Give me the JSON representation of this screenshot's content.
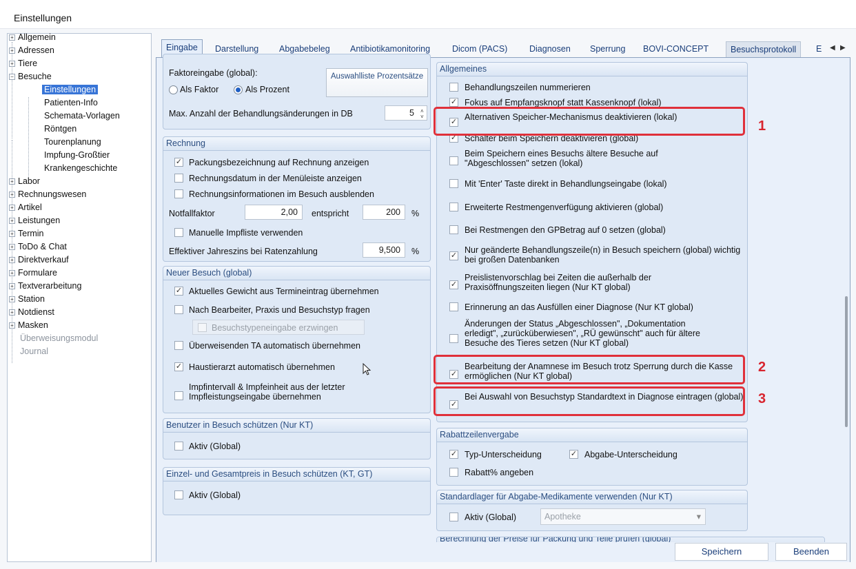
{
  "window": {
    "title": "Einstellungen"
  },
  "tree": {
    "items": [
      {
        "label": "Allgemein",
        "exp": "+"
      },
      {
        "label": "Adressen",
        "exp": "+"
      },
      {
        "label": "Tiere",
        "exp": "+"
      },
      {
        "label": "Besuche",
        "exp": "−"
      },
      {
        "label": "Einstellungen"
      },
      {
        "label": "Patienten-Info"
      },
      {
        "label": "Schemata-Vorlagen"
      },
      {
        "label": "Röntgen"
      },
      {
        "label": "Tourenplanung"
      },
      {
        "label": "Impfung-Großtier"
      },
      {
        "label": "Krankengeschichte"
      },
      {
        "label": "Labor",
        "exp": "+"
      },
      {
        "label": "Rechnungswesen",
        "exp": "+"
      },
      {
        "label": "Artikel",
        "exp": "+"
      },
      {
        "label": "Leistungen",
        "exp": "+"
      },
      {
        "label": "Termin",
        "exp": "+"
      },
      {
        "label": "ToDo & Chat",
        "exp": "+"
      },
      {
        "label": "Direktverkauf",
        "exp": "+"
      },
      {
        "label": "Formulare",
        "exp": "+"
      },
      {
        "label": "Textverarbeitung",
        "exp": "+"
      },
      {
        "label": "Station",
        "exp": "+"
      },
      {
        "label": "Notdienst",
        "exp": "+"
      },
      {
        "label": "Masken",
        "exp": "+"
      },
      {
        "label": "Überweisungsmodul"
      },
      {
        "label": "Journal"
      }
    ]
  },
  "tabs": [
    "Eingabe",
    "Darstellung",
    "Abgabebeleg",
    "Antibiotikamonitoring",
    "Dicom (PACS)",
    "Diagnosen",
    "Sperrung",
    "BOVI-CONCEPT",
    "Besuchsprotokoll",
    "E"
  ],
  "left": {
    "faktor": {
      "label": "Faktoreingabe (global):",
      "radio1": "Als Faktor",
      "radio2": "Als Prozent",
      "btn": "Auswahlliste Prozentsätze",
      "max_label": "Max. Anzahl der Behandlungsänderungen in DB",
      "max_value": "5"
    },
    "rechnung": {
      "title": "Rechnung",
      "items": [
        "Packungsbezeichnung auf Rechnung anzeigen",
        "Rechnungsdatum in der Menüleiste anzeigen",
        "Rechnungsinformationen im Besuch ausblenden"
      ],
      "notfall_label": "Notfallfaktor",
      "notfall_value": "2,00",
      "entspricht": "entspricht",
      "prozent_value": "200",
      "percent": "%",
      "impf": "Manuelle Impfliste verwenden",
      "zins_label": "Effektiver Jahreszins bei Ratenzahlung",
      "zins_value": "9,500",
      "zins_percent": "%"
    },
    "neuer": {
      "title": "Neuer Besuch (global)",
      "items": [
        "Aktuelles Gewicht aus Termineintrag übernehmen",
        "Nach Bearbeiter, Praxis und Besuchstyp fragen",
        "Besuchstypeneingabe erzwingen",
        "Überweisenden TA automatisch übernehmen",
        "Haustierarzt automatisch übernehmen",
        "Impfintervall & Impfeinheit aus der letzter Impfleistungseingabe übernehmen"
      ]
    },
    "benutzer": {
      "title": "Benutzer in Besuch schützen (Nur KT)",
      "item": "Aktiv (Global)"
    },
    "preis": {
      "title": "Einzel- und Gesamtpreis in Besuch schützen (KT, GT)",
      "item": "Aktiv (Global)"
    }
  },
  "right": {
    "allgemeines": {
      "title": "Allgemeines",
      "items": [
        "Behandlungszeilen nummerieren",
        "Fokus auf Empfangsknopf statt Kassenknopf (lokal)",
        "Alternativen Speicher-Mechanismus deaktivieren (lokal)",
        "Schalter beim Speichern deaktivieren (global)",
        "Beim Speichern eines Besuchs ältere Besuche auf \"Abgeschlossen\" setzen (lokal)",
        "Mit 'Enter' Taste direkt in Behandlungseingabe (lokal)",
        "Erweiterte Restmengenverfügung aktivieren (global)",
        "Bei Restmengen den GPBetrag auf 0 setzen (global)",
        "Nur geänderte Behandlungszeile(n) in Besuch speichern (global) wichtig bei großen Datenbanken",
        "Preislistenvorschlag bei Zeiten die außerhalb der Praxisöffnungszeiten liegen (Nur KT global)",
        "Erinnerung an das Ausfüllen einer Diagnose (Nur KT global)",
        "Änderungen der Status „Abgeschlossen\", „Dokumentation erledigt\", „zurücküberwiesen\", „RÜ gewünscht\" auch für ältere Besuche des Tieres setzen (Nur KT global)",
        "Bearbeitung der Anamnese im Besuch trotz Sperrung durch die Kasse ermöglichen (Nur KT global)",
        "Bei Auswahl von Besuchstyp Standardtext in Diagnose eintragen (global)"
      ]
    },
    "rabatt": {
      "title": "Rabattzeilenvergabe",
      "typ": "Typ-Unterscheidung",
      "abgabe": "Abgabe-Unterscheidung",
      "prozent": "Rabatt% angeben"
    },
    "lager": {
      "title": "Standardlager für Abgabe-Medikamente verwenden (Nur KT)",
      "item": "Aktiv (Global)",
      "select": "Apotheke"
    },
    "berechnung": {
      "title": "Berechnung der Preise für Packung und Teile prüfen (global)"
    }
  },
  "markers": [
    "1",
    "2",
    "3"
  ],
  "buttons": {
    "save": "Speichern",
    "end": "Beenden"
  },
  "colors": {
    "highlight": "#e0303a",
    "selection": "#3875d7"
  }
}
